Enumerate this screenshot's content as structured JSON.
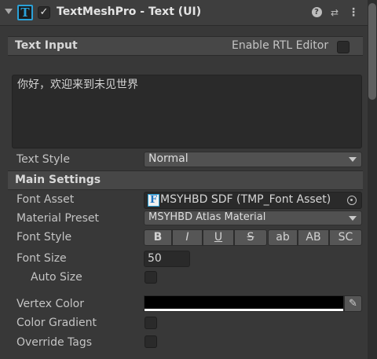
{
  "component": {
    "icon_letter": "T",
    "enabled": true,
    "title": "TextMeshPro - Text (UI)",
    "help_icon": "?",
    "presets_icon": "⇄",
    "menu_icon": "⋮"
  },
  "text_input": {
    "section_title": "Text Input",
    "rtl_label": "Enable RTL Editor",
    "rtl_enabled": false,
    "text": "你好，欢迎来到未见世界",
    "text_style_label": "Text Style",
    "text_style_value": "Normal"
  },
  "main_settings": {
    "section_title": "Main Settings",
    "font_asset_label": "Font Asset",
    "font_asset_icon_letter": "F",
    "font_asset_value": "MSYHBD SDF (TMP_Font Asset)",
    "material_preset_label": "Material Preset",
    "material_preset_value": "MSYHBD Atlas Material",
    "font_style_label": "Font Style",
    "font_style_buttons": [
      "B",
      "I",
      "U",
      "S",
      "ab",
      "AB",
      "SC"
    ],
    "font_size_label": "Font Size",
    "font_size_value": "50",
    "auto_size_label": "Auto Size",
    "auto_size_enabled": false,
    "vertex_color_label": "Vertex Color",
    "vertex_color": "#000000",
    "color_gradient_label": "Color Gradient",
    "color_gradient_enabled": false,
    "override_tags_label": "Override Tags",
    "override_tags_enabled": false
  },
  "colors": {
    "tmp_accent": "#2aa1d8",
    "panel_background": "#383838"
  }
}
